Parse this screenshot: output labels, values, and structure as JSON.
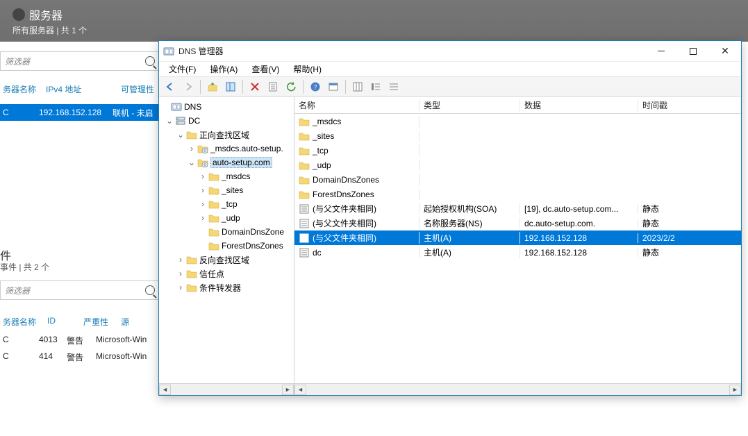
{
  "background": {
    "title": "服务器",
    "subtitle": "所有服务器 | 共 1 个",
    "filter_placeholder": "筛选器",
    "cols": {
      "name": "务器名称",
      "ip": "IPv4 地址",
      "manage": "可管理性"
    },
    "row": {
      "c1": "C",
      "ip": "192.168.152.128",
      "state": "联机 - 未启"
    },
    "section2_title": "件",
    "section2_sub": "事件 | 共 2 个",
    "ev_cols": {
      "name": "务器名称",
      "id": "ID",
      "sev": "严重性",
      "src": "源"
    },
    "events": [
      {
        "name": "C",
        "id": "4013",
        "sev": "警告",
        "src": "Microsoft-Win"
      },
      {
        "name": "C",
        "id": "414",
        "sev": "警告",
        "src": "Microsoft-Win"
      }
    ]
  },
  "window": {
    "title": "DNS 管理器",
    "menu": {
      "file": "文件(F)",
      "action": "操作(A)",
      "view": "查看(V)",
      "help": "帮助(H)"
    }
  },
  "tree": {
    "root": "DNS",
    "dc": "DC",
    "fwd_zone": "正向查找区域",
    "msdcs_zone": "_msdcs.auto-setup.",
    "auto_zone": "auto-setup.com",
    "children": {
      "msdcs": "_msdcs",
      "sites": "_sites",
      "tcp": "_tcp",
      "udp": "_udp",
      "ddz": "DomainDnsZone",
      "fdz": "ForestDnsZones"
    },
    "rev_zone": "反向查找区域",
    "trust": "信任点",
    "cond_fwd": "条件转发器"
  },
  "list": {
    "headers": {
      "name": "名称",
      "type": "类型",
      "data": "数据",
      "ts": "时间戳"
    },
    "rows": [
      {
        "icon": "folder",
        "name": "_msdcs",
        "type": "",
        "data": "",
        "ts": "",
        "selected": false
      },
      {
        "icon": "folder",
        "name": "_sites",
        "type": "",
        "data": "",
        "ts": "",
        "selected": false
      },
      {
        "icon": "folder",
        "name": "_tcp",
        "type": "",
        "data": "",
        "ts": "",
        "selected": false
      },
      {
        "icon": "folder",
        "name": "_udp",
        "type": "",
        "data": "",
        "ts": "",
        "selected": false
      },
      {
        "icon": "folder",
        "name": "DomainDnsZones",
        "type": "",
        "data": "",
        "ts": "",
        "selected": false
      },
      {
        "icon": "folder",
        "name": "ForestDnsZones",
        "type": "",
        "data": "",
        "ts": "",
        "selected": false
      },
      {
        "icon": "record",
        "name": "(与父文件夹相同)",
        "type": "起始授权机构(SOA)",
        "data": "[19], dc.auto-setup.com...",
        "ts": "静态",
        "selected": false
      },
      {
        "icon": "record",
        "name": "(与父文件夹相同)",
        "type": "名称服务器(NS)",
        "data": "dc.auto-setup.com.",
        "ts": "静态",
        "selected": false
      },
      {
        "icon": "record",
        "name": "(与父文件夹相同)",
        "type": "主机(A)",
        "data": "192.168.152.128",
        "ts": "2023/2/2",
        "selected": true
      },
      {
        "icon": "record",
        "name": "dc",
        "type": "主机(A)",
        "data": "192.168.152.128",
        "ts": "静态",
        "selected": false
      }
    ]
  }
}
